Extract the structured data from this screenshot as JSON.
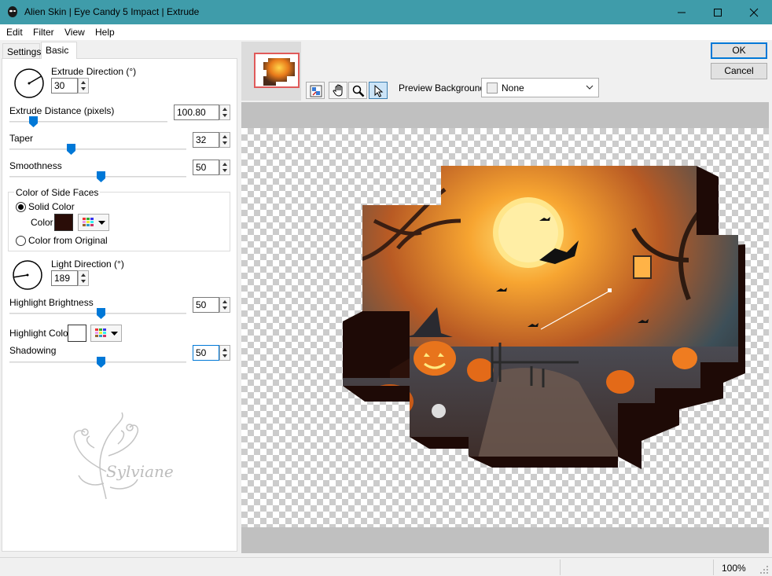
{
  "window": {
    "title": "Alien Skin | Eye Candy 5 Impact | Extrude",
    "titlebar_color": "#3f9caa"
  },
  "menu": {
    "items": [
      "Edit",
      "Filter",
      "View",
      "Help"
    ]
  },
  "tabs": {
    "settings": "Settings",
    "basic": "Basic"
  },
  "basic": {
    "extrude_direction": {
      "label": "Extrude Direction (°)",
      "value": "30"
    },
    "extrude_distance": {
      "label": "Extrude Distance (pixels)",
      "value": "100.80",
      "slider_fraction": 0.13
    },
    "taper": {
      "label": "Taper",
      "value": "32",
      "slider_fraction": 0.32
    },
    "smoothness": {
      "label": "Smoothness",
      "value": "50",
      "slider_fraction": 0.5
    },
    "side_faces": {
      "group_label": "Color of Side Faces",
      "solid_label": "Solid Color",
      "color_label": "Color",
      "color_value": "#2a0d08",
      "original_label": "Color from Original",
      "selected": "Solid Color"
    },
    "light_direction": {
      "label": "Light Direction (°)",
      "value": "189"
    },
    "highlight_brightness": {
      "label": "Highlight Brightness",
      "value": "50",
      "slider_fraction": 0.5
    },
    "highlight_color": {
      "label": "Highlight Color",
      "value": "#ffffff"
    },
    "shadowing": {
      "label": "Shadowing",
      "value": "50",
      "slider_fraction": 0.5
    }
  },
  "watermark": "Sylviane",
  "toolbar": {
    "tools": [
      "preview-toggle-icon",
      "hand-icon",
      "zoom-icon",
      "pointer-icon"
    ],
    "preview_background_label": "Preview Background:",
    "preview_background_value": "None"
  },
  "buttons": {
    "ok": "OK",
    "cancel": "Cancel"
  },
  "status": {
    "zoom": "100%"
  }
}
